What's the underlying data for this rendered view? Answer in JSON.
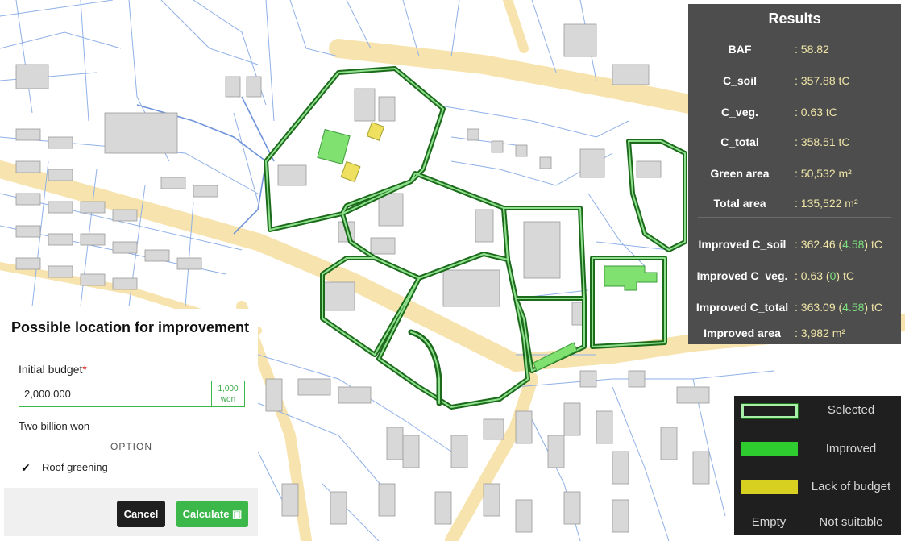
{
  "results": {
    "title": "Results",
    "rows": [
      {
        "label": "BAF",
        "value": ": 58.82"
      },
      {
        "label": "C_soil",
        "value": ": 357.88 tC"
      },
      {
        "label": "C_veg.",
        "value": ": 0.63 tC"
      },
      {
        "label": "C_total",
        "value": ": 358.51 tC"
      },
      {
        "label": "Green area",
        "value": ": 50,532 m²"
      },
      {
        "label": "Total area",
        "value": ": 135,522 m²"
      }
    ],
    "improved_rows": [
      {
        "label": "Improved C_soil",
        "prefix": ": 362.46 (",
        "delta": "4.58",
        "suffix": ") tC"
      },
      {
        "label": "Improved C_veg.",
        "prefix": ": 0.63 (",
        "delta": "0",
        "suffix": ") tC"
      },
      {
        "label": "Improved C_total",
        "prefix": ": 363.09 (",
        "delta": "4.58",
        "suffix": ") tC"
      },
      {
        "label": "Improved area",
        "prefix": ": 3,982 m²",
        "delta": "",
        "suffix": ""
      }
    ]
  },
  "legend": {
    "selected": "Selected",
    "improved": "Improved",
    "lack_of_budget": "Lack of budget",
    "empty": "Empty",
    "not_suitable": "Not suitable"
  },
  "panel": {
    "title": "Possible location for improvement",
    "budget_label": "Initial budget",
    "required_mark": "*",
    "budget_value": "2,000,000",
    "unit_line1": "1,000",
    "unit_line2": "won",
    "budget_words": "Two billion won",
    "option_label": "OPTION",
    "roof_greening_label": "Roof greening",
    "roof_greening_checked": "✔",
    "cancel_label": "Cancel",
    "calculate_label": "Calculate ▣"
  },
  "colors": {
    "accent_green": "#3cb84a",
    "selected_outline": "#1b6b1b",
    "improved_fill": "#80e070",
    "lack_of_budget_fill": "#f0e060",
    "results_bg": "#4d4d4d",
    "legend_bg": "#1f1f1f",
    "road": "#f7e3ad",
    "building": "#d8d8d8",
    "parcel_line": "#8fb0e8"
  }
}
